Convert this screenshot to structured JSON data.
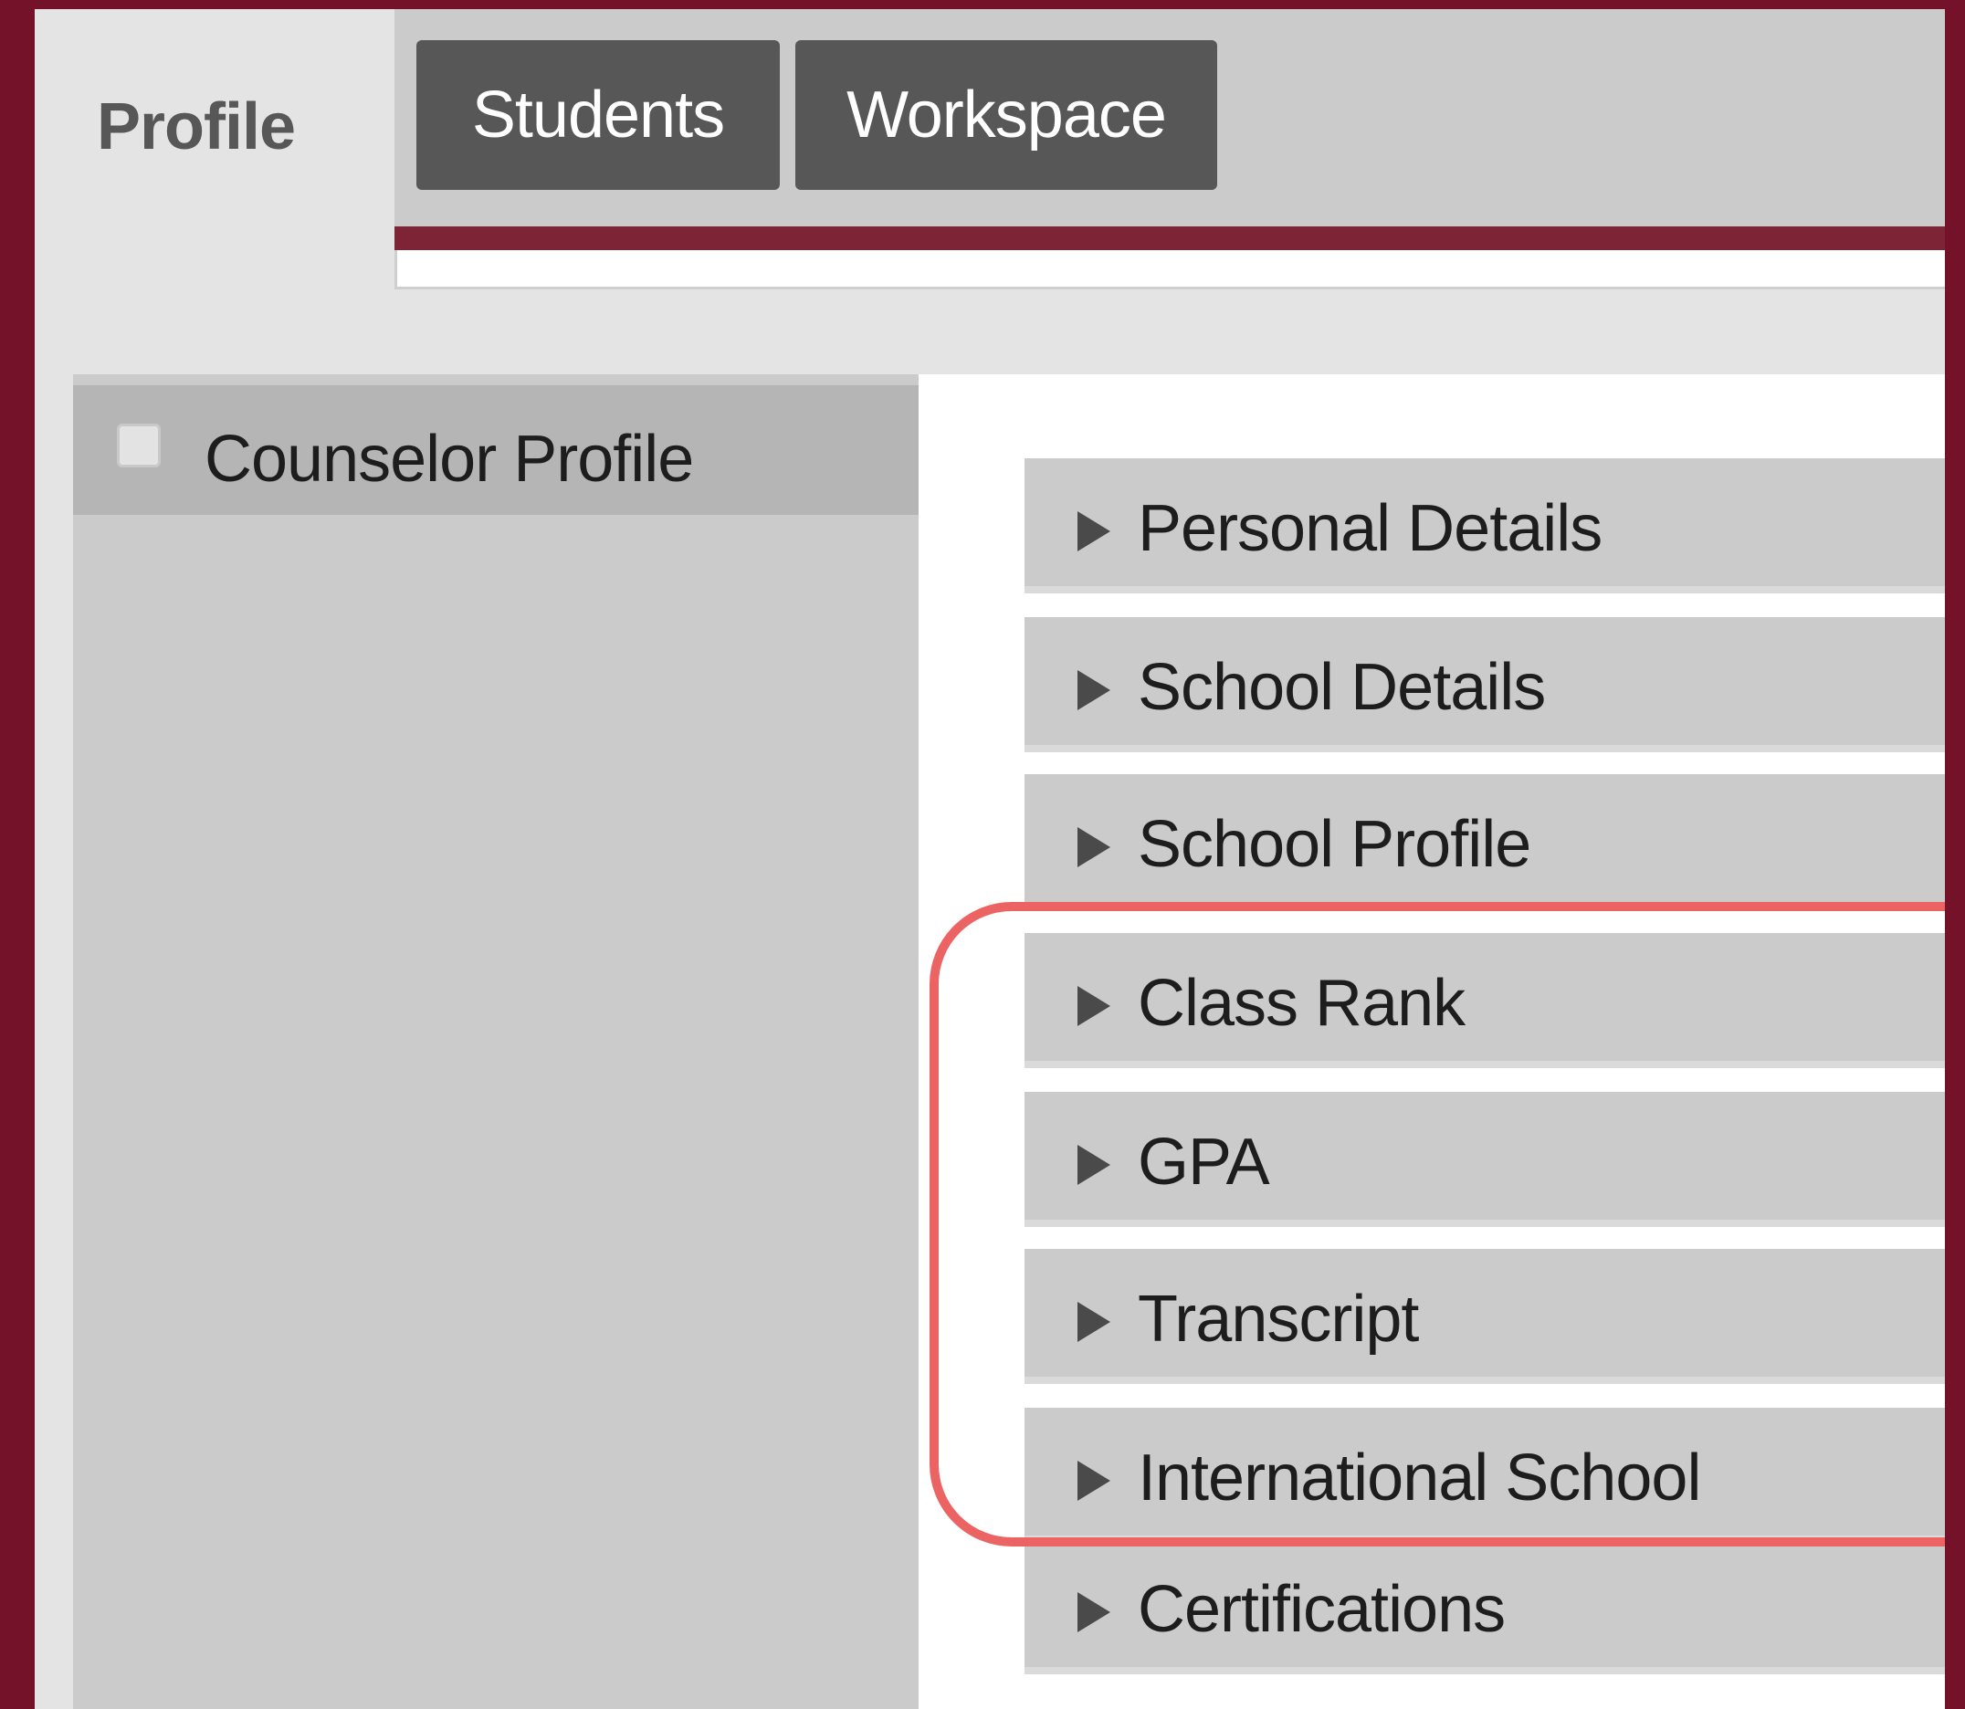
{
  "tabs": {
    "profile": "Profile",
    "students": "Students",
    "workspace": "Workspace"
  },
  "sidebar": {
    "items": [
      {
        "label": "Counselor Profile",
        "checked": false
      }
    ]
  },
  "sections": [
    {
      "label": "Personal Details"
    },
    {
      "label": "School Details"
    },
    {
      "label": "School Profile"
    },
    {
      "label": "Class Rank"
    },
    {
      "label": "GPA"
    },
    {
      "label": "Transcript"
    },
    {
      "label": "International School"
    },
    {
      "label": "Certifications"
    }
  ],
  "colors": {
    "frame_border": "#74122a",
    "accent_bar": "#7e2437",
    "tab_dark": "#575757",
    "highlight": "#ec6363"
  }
}
